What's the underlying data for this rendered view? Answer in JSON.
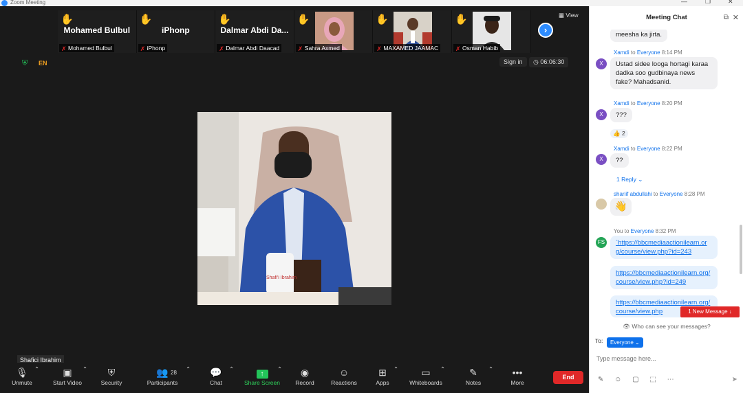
{
  "window": {
    "title": "Zoom Meeting",
    "controls": [
      "—",
      "❐",
      "✕"
    ]
  },
  "strip": {
    "tiles": [
      {
        "big": "Mohamed Bulbul",
        "label": "Mohamed Bulbul",
        "photo": false
      },
      {
        "big": "iPhonp",
        "label": "iPhonp",
        "photo": false
      },
      {
        "big": "Dalmar Abdi Da...",
        "label": "Dalmar Abdi Daacad",
        "photo": false
      },
      {
        "big": "",
        "label": "Sahra Axmed",
        "photo": true,
        "bg": "#c8a88a"
      },
      {
        "big": "",
        "label": "MAXAMED JAAMAC",
        "photo": true,
        "bg": "#8a6a4e"
      },
      {
        "big": "",
        "label": "Osman Habib",
        "photo": true,
        "bg": "#d8d8d8"
      }
    ],
    "view_label": "View"
  },
  "status": {
    "lang": "EN",
    "signin": "Sign in",
    "timer": "06:06:30"
  },
  "speaker": {
    "name": "Shafici Ibrahim",
    "mug_text": "Shafi'i Ibrahim"
  },
  "toolbar": {
    "unmute": "Unmute",
    "start_video": "Start Video",
    "security": "Security",
    "participants": "Participants",
    "participants_count": "28",
    "chat": "Chat",
    "share": "Share Screen",
    "record": "Record",
    "reactions": "Reactions",
    "apps": "Apps",
    "whiteboards": "Whiteboards",
    "notes": "Notes",
    "more": "More",
    "end": "End"
  },
  "chat": {
    "title": "Meeting Chat",
    "to_word": "to",
    "everyone": "Everyone",
    "messages": [
      {
        "text": "meesha ka jirta."
      },
      {
        "sender": "Xamdi",
        "time": "8:14 PM",
        "text": "Ustad sidee looga hortagi karaa dadka soo gudbinaya news fake? Mahadsanid."
      },
      {
        "sender": "Xamdi",
        "time": "8:20 PM",
        "text": "???",
        "reaction": "👍 2"
      },
      {
        "sender": "Xamdi",
        "time": "8:22 PM",
        "text": "??",
        "reply": "1 Reply"
      },
      {
        "sender": "shariif abdullahi",
        "time": "8:28 PM",
        "text": "👋"
      },
      {
        "sender": "You",
        "time": "8:32 PM",
        "links": [
          "`https://bbcmediaactionilearn.org/course/view.php?id=243",
          "https://bbcmediaactionilearn.org/course/view.php?id=249",
          "https://bbcmediaactionilearn.org/course/view.php"
        ]
      }
    ],
    "avatar_x": "X",
    "avatar_fs": "FS",
    "new_message": "1 New Message",
    "who_can_see": "Who can see your messages?",
    "to_label": "To:",
    "recipient": "Everyone",
    "input_placeholder": "Type message here..."
  },
  "colors": {
    "accent": "#0e71eb",
    "end": "#e02828",
    "green": "#23c45a"
  }
}
